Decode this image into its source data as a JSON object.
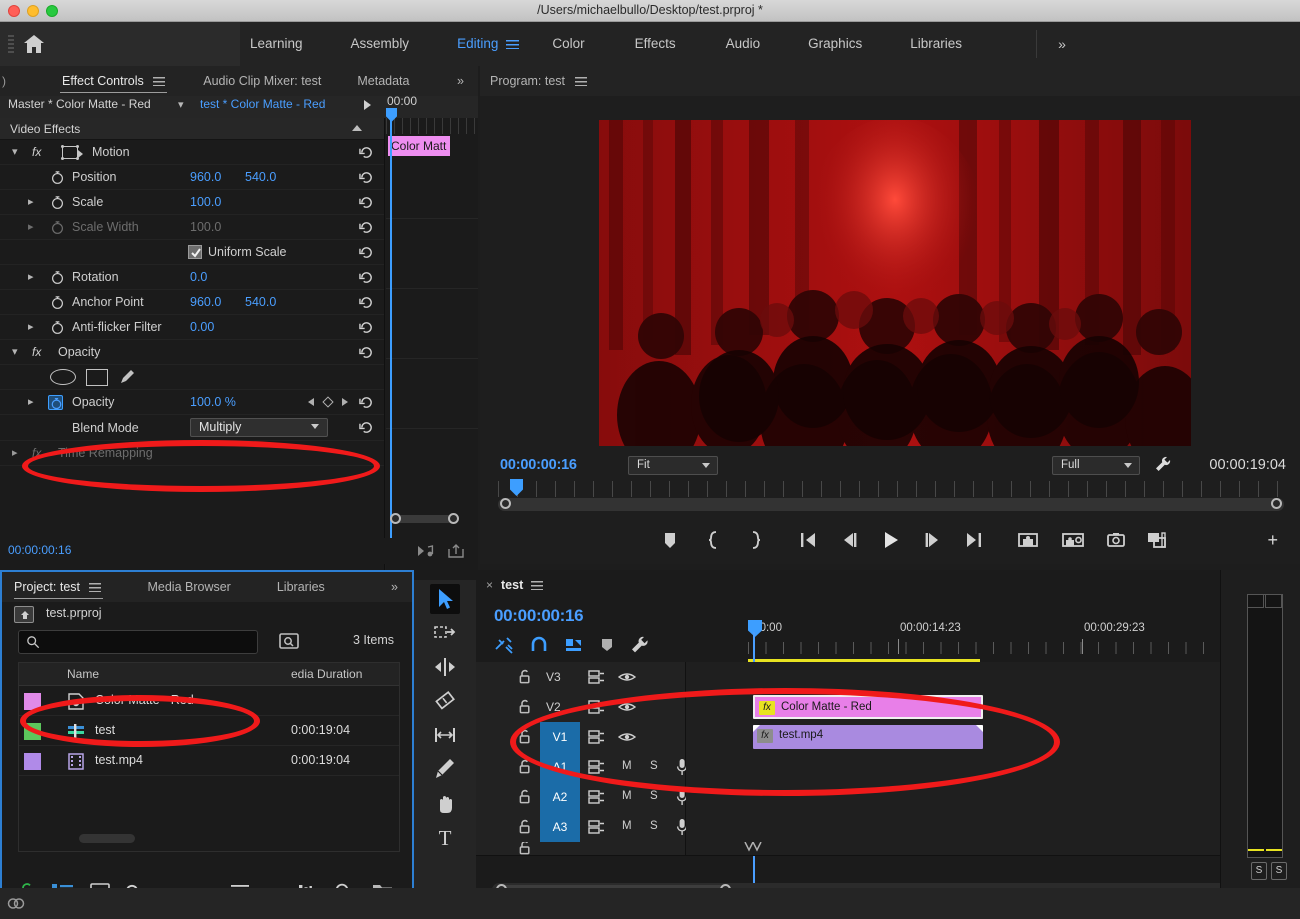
{
  "window": {
    "title": "/Users/michaelbullo/Desktop/test.prproj *"
  },
  "workspace": {
    "items": [
      {
        "label": "Learning"
      },
      {
        "label": "Assembly"
      },
      {
        "label": "Editing",
        "active": true
      },
      {
        "label": "Color"
      },
      {
        "label": "Effects"
      },
      {
        "label": "Audio"
      },
      {
        "label": "Graphics"
      },
      {
        "label": "Libraries"
      }
    ],
    "more_label": "»",
    "home_icon": "home-icon"
  },
  "effect_controls": {
    "tabs": [
      {
        "label": "Effect Controls",
        "selected": true
      },
      {
        "label": "Audio Clip Mixer: test",
        "selected": false
      },
      {
        "label": "Metadata",
        "selected": false
      }
    ],
    "more_label": "»",
    "master_clip": "Master * Color Matte - Red",
    "sequence_clip": "test * Color Matte - Red",
    "section_label": "Video Effects",
    "timecode": "00:00:00:16",
    "ruler_time": "00:00",
    "keyframe_clip_label": "Color Matt",
    "properties": [
      {
        "name": "Motion",
        "type": "group",
        "icon": "fx-icon"
      },
      {
        "name": "Position",
        "values": [
          "960.0",
          "540.0"
        ],
        "type": "prop",
        "disclosure": false
      },
      {
        "name": "Scale",
        "values": [
          "100.0"
        ],
        "type": "prop",
        "disclosure": true
      },
      {
        "name": "Scale Width",
        "values": [
          "100.0"
        ],
        "type": "prop",
        "disclosure": true,
        "dim": true
      },
      {
        "name": "Uniform Scale",
        "type": "checkbox",
        "checked": true
      },
      {
        "name": "Rotation",
        "values": [
          "0.0"
        ],
        "type": "prop",
        "disclosure": true
      },
      {
        "name": "Anchor Point",
        "values": [
          "960.0",
          "540.0"
        ],
        "type": "prop",
        "disclosure": false
      },
      {
        "name": "Anti-flicker Filter",
        "values": [
          "0.00"
        ],
        "type": "prop",
        "disclosure": true
      },
      {
        "name": "Opacity",
        "type": "group",
        "icon": "fx-icon"
      },
      {
        "name": "Opacity",
        "values": [
          "100.0 %"
        ],
        "type": "prop",
        "disclosure": true
      },
      {
        "name": "Blend Mode",
        "value": "Multiply",
        "type": "dropdown"
      },
      {
        "name": "Time Remapping",
        "type": "group",
        "icon": "fx-icon",
        "dim": true
      }
    ],
    "blend_mode_label": "Blend Mode",
    "blend_mode_value": "Multiply"
  },
  "program_monitor": {
    "title": "Program: test",
    "timecode": "00:00:00:16",
    "fit_value": "Fit",
    "quality_value": "Full",
    "duration": "00:00:19:04",
    "buttons": [
      {
        "name": "add-marker-button"
      },
      {
        "name": "mark-in-button"
      },
      {
        "name": "mark-out-button"
      },
      {
        "name": "go-to-in-button"
      },
      {
        "name": "step-back-button"
      },
      {
        "name": "play-stop-button"
      },
      {
        "name": "step-forward-button"
      },
      {
        "name": "go-to-out-button"
      },
      {
        "name": "lift-button"
      },
      {
        "name": "extract-button"
      },
      {
        "name": "export-frame-button"
      },
      {
        "name": "comparison-view-button"
      }
    ],
    "plus_label": "+"
  },
  "project": {
    "tabs": [
      {
        "label": "Project: test",
        "selected": true
      },
      {
        "label": "Media Browser",
        "selected": false
      },
      {
        "label": "Libraries",
        "selected": false
      }
    ],
    "more_label": "»",
    "project_name": "test.prproj",
    "search_placeholder": "",
    "item_count": "3 Items",
    "columns": [
      "Name",
      "edia Duration"
    ],
    "rows": [
      {
        "name": "Color Matte - Red",
        "duration": "",
        "swatch": "#e08ae8",
        "icon": "color-matte-icon"
      },
      {
        "name": "test",
        "duration": "0:00:19:04",
        "swatch": "#5cc65c",
        "icon": "sequence-icon"
      },
      {
        "name": "test.mp4",
        "duration": "0:00:19:04",
        "swatch": "#b08ae8",
        "icon": "video-clip-icon"
      }
    ],
    "footer_buttons": [
      {
        "name": "lock-icon"
      },
      {
        "name": "list-view-icon"
      },
      {
        "name": "icon-view-icon"
      },
      {
        "name": "zoom-slider"
      },
      {
        "name": "sort-icon"
      },
      {
        "name": "chevron-down-icon"
      },
      {
        "name": "freeform-icon"
      },
      {
        "name": "find-icon"
      },
      {
        "name": "new-bin-icon"
      }
    ]
  },
  "timeline": {
    "tab_label": "test",
    "close_label": "×",
    "timecode": "00:00:00:16",
    "tools": [
      {
        "name": "selection-tool",
        "active": true
      },
      {
        "name": "track-select-forward-tool"
      },
      {
        "name": "ripple-edit-tool"
      },
      {
        "name": "rolling-edit-tool"
      },
      {
        "name": "rate-stretch-tool"
      },
      {
        "name": "pen-tool"
      },
      {
        "name": "hand-tool"
      },
      {
        "name": "type-tool"
      }
    ],
    "header_tools": [
      {
        "name": "insert-overwrite-icon"
      },
      {
        "name": "snap-icon"
      },
      {
        "name": "linked-selection-icon"
      },
      {
        "name": "add-marker-icon"
      },
      {
        "name": "timeline-settings-icon"
      }
    ],
    "ruler_labels": [
      ":00:00",
      "00:00:14:23",
      "00:00:29:23"
    ],
    "tracks": [
      {
        "name": "V3",
        "type": "video",
        "targeted": false
      },
      {
        "name": "V2",
        "type": "video",
        "targeted": false
      },
      {
        "name": "V1",
        "type": "video",
        "targeted": true
      },
      {
        "name": "A1",
        "type": "audio",
        "targeted": true,
        "m": "M",
        "s": "S"
      },
      {
        "name": "A2",
        "type": "audio",
        "targeted": true,
        "m": "M",
        "s": "S"
      },
      {
        "name": "A3",
        "type": "audio",
        "targeted": true,
        "m": "M",
        "s": "S"
      }
    ],
    "clips": [
      {
        "label": "Color Matte - Red",
        "track": "V2",
        "color": "#e87fe8",
        "fx": "fx",
        "fx_bg": "#e8e321"
      },
      {
        "label": "test.mp4",
        "track": "V1",
        "color": "#a98ae0",
        "fx": "fx",
        "fx_bg": "#8d8d8d"
      }
    ],
    "meter_s_labels": [
      "S",
      "S"
    ]
  },
  "annotations": [
    {
      "name": "blend-mode-highlight"
    },
    {
      "name": "project-item-highlight"
    },
    {
      "name": "timeline-clips-highlight"
    }
  ],
  "status": {
    "cc_icon": "creative-cloud-icon"
  }
}
